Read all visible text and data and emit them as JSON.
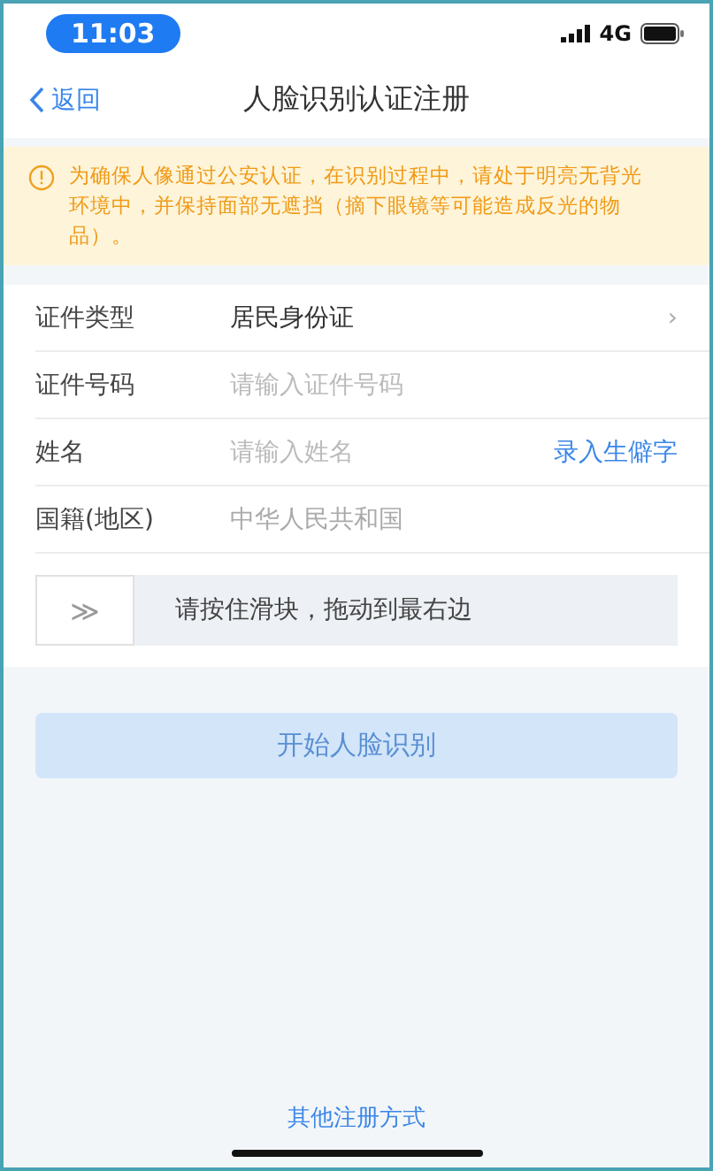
{
  "status_bar": {
    "time": "11:03",
    "network": "4G"
  },
  "nav": {
    "back": "返回",
    "title": "人脸识别认证注册"
  },
  "notice": {
    "text": "为确保人像通过公安认证，在识别过程中，请处于明亮无背光环境中，并保持面部无遮挡（摘下眼镜等可能造成反光的物品）。"
  },
  "fields": [
    {
      "kind": "select",
      "label": "证件类型",
      "value": "居民身份证",
      "chevron": "›"
    },
    {
      "kind": "input",
      "label": "证件号码",
      "placeholder": "请输入证件号码"
    },
    {
      "kind": "input",
      "label": "姓名",
      "placeholder": "请输入姓名",
      "action": "录入生僻字"
    },
    {
      "kind": "value",
      "label": "国籍(地区)",
      "value": "中华人民共和国"
    }
  ],
  "slider": {
    "handle": "≫",
    "hint": "请按住滑块，拖动到最右边",
    "level": 0
  },
  "start_button": {
    "label": "开始人脸识别",
    "disabled": true
  },
  "footer_link": "其他注册方式"
}
